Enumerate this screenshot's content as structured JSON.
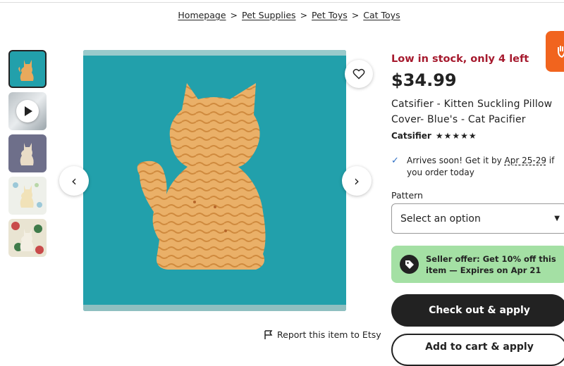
{
  "breadcrumb": {
    "items": [
      "Homepage",
      "Pet Supplies",
      "Pet Toys",
      "Cat Toys"
    ],
    "separator": ">"
  },
  "gallery": {
    "thumbnails": [
      "cat-pillow-blue",
      "video",
      "cat-pillow-gray",
      "cat-pillow-pastel",
      "cat-pillow-floral"
    ],
    "active_index": 0,
    "prev_icon": "chevron-left-icon",
    "next_icon": "chevron-right-icon",
    "favorite_icon": "heart-icon",
    "report_label": "Report this item to Etsy"
  },
  "product": {
    "stock_notice": "Low in stock, only 4 left",
    "price": "$34.99",
    "title": "Catsifier - Kitten Suckling Pillow Cover- Blue's - Cat Pacifier",
    "shop_name": "Catsifier",
    "rating_stars": "★★★★★",
    "rating": 5,
    "arrival_prefix": "Arrives soon! Get it by ",
    "arrival_dates": "Apr 25-29",
    "arrival_suffix": " if you order today"
  },
  "options": {
    "pattern_label": "Pattern",
    "select_value": "Select an option"
  },
  "offer": {
    "text": "Seller offer: Get 10% off this item — Expires on Apr 21"
  },
  "actions": {
    "checkout_label": "Check out & apply",
    "add_to_cart_label": "Add to cart & apply"
  },
  "colors": {
    "stock": "#a61a2e",
    "offer_bg": "#a4e0a4",
    "brand_orange": "#f1641e",
    "image_teal": "#22a0ab"
  }
}
